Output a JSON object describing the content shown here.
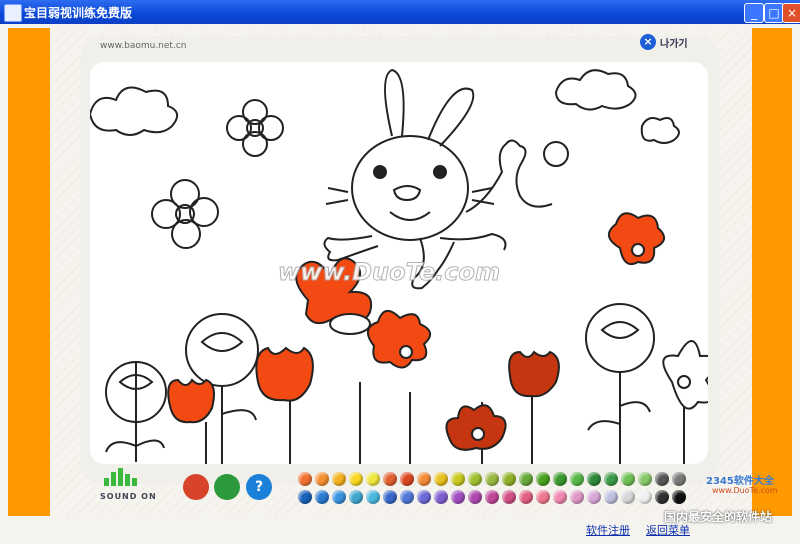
{
  "window": {
    "title": "宝目弱视训练免费版",
    "min": "_",
    "max": "□",
    "close": "×"
  },
  "header": {
    "url": "www.baomu.net.cn",
    "exit_label": "나가기",
    "exit_icon": "×"
  },
  "watermark": "www.DuoTe.com",
  "audio": {
    "label": "SOUND ON"
  },
  "tools": {
    "eraser": "",
    "reset": "",
    "help": "?"
  },
  "palette": {
    "row1": [
      "#f07030",
      "#f49030",
      "#f4b020",
      "#f8d820",
      "#f0e83c",
      "#e06030",
      "#d94820",
      "#f28c38",
      "#e8c020",
      "#c8c820",
      "#a0c030",
      "#98b840",
      "#90b028",
      "#68a838",
      "#4aa020",
      "#3a9a2c",
      "#58b848",
      "#2e8a38",
      "#3c9a48",
      "#70c058",
      "#88c86a",
      "#585858",
      "#7a7a7a"
    ],
    "row2": [
      "#1860b8",
      "#2a7ad0",
      "#3a94e0",
      "#40a8d0",
      "#4ab8e0",
      "#3868c8",
      "#5078d8",
      "#6a6ad8",
      "#8060d0",
      "#a050c0",
      "#b048b0",
      "#c04898",
      "#d05088",
      "#e06080",
      "#f07890",
      "#f088b0",
      "#e098c8",
      "#d8a8d8",
      "#c0c0e0",
      "#d8d8d8",
      "#f0f0f0",
      "#303030",
      "#101010"
    ]
  },
  "links": {
    "register": "软件注册",
    "back_menu": "返回菜单"
  },
  "branding": {
    "brand_a": "2345软件大全",
    "brand_b": "www.DuoTe.com",
    "brand_c": "国内最安全的软件站"
  }
}
